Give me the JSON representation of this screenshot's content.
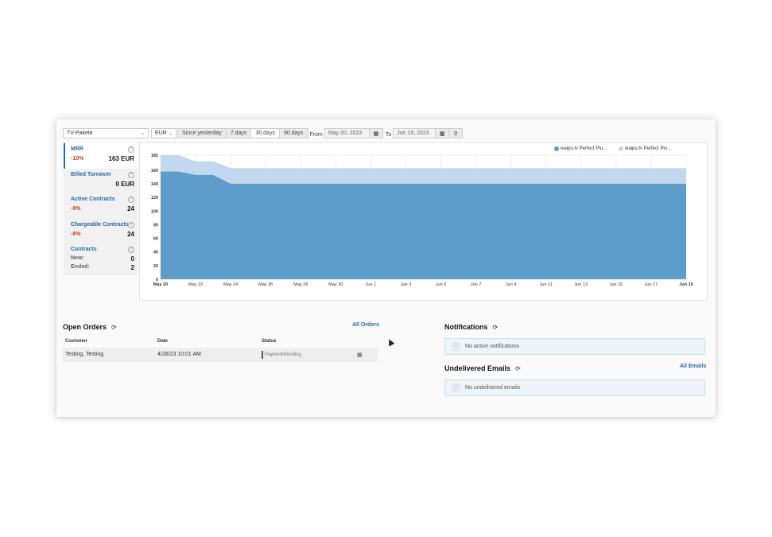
{
  "toolbar": {
    "product": "TV-Pakete",
    "currency": "EUR",
    "range_buttons": [
      "Since yesterday",
      "7 days",
      "30 days",
      "90 days"
    ],
    "active_range": "30 days",
    "from_label": "From",
    "from_date": "May 20, 2023",
    "to_label": "To",
    "to_date": "Jun 19, 2023"
  },
  "kpis": [
    {
      "title": "MRR",
      "pct": "-10%",
      "value": "163 EUR",
      "selected": true
    },
    {
      "title": "Billed Turnover",
      "pct": "",
      "value": "0 EUR"
    },
    {
      "title": "Active Contracts",
      "pct": "-8%",
      "value": "24"
    },
    {
      "title": "Chargeable Contracts",
      "pct": "-8%",
      "value": "24"
    }
  ],
  "contracts_kpi": {
    "title": "Contracts",
    "new_label": "New:",
    "new_value": "0",
    "ended_label": "Ended:",
    "ended_value": "2"
  },
  "colors": {
    "accent": "#2a66a8",
    "series1": "#5e9dca",
    "series2": "#c3d8ee",
    "negative": "#d0442b"
  },
  "chart_data": {
    "type": "area",
    "stacked": true,
    "x": [
      "May 20",
      "May 21",
      "May 22",
      "May 23",
      "May 24",
      "May 25",
      "May 26",
      "May 27",
      "May 28",
      "May 29",
      "May 30",
      "May 31",
      "Jun 1",
      "Jun 2",
      "Jun 3",
      "Jun 4",
      "Jun 5",
      "Jun 6",
      "Jun 7",
      "Jun 8",
      "Jun 9",
      "Jun 10",
      "Jun 11",
      "Jun 12",
      "Jun 13",
      "Jun 14",
      "Jun 15",
      "Jun 16",
      "Jun 17",
      "Jun 18",
      "Jun 19"
    ],
    "x_ticks": [
      "May 20",
      "May 22",
      "May 24",
      "May 26",
      "May 28",
      "May 30",
      "Jun 1",
      "Jun 3",
      "Jun 5",
      "Jun 7",
      "Jun 9",
      "Jun 11",
      "Jun 13",
      "Jun 15",
      "Jun 17",
      "Jun 19"
    ],
    "series": [
      {
        "name": "waipu.tv Perfect Plu...",
        "values": [
          158,
          158,
          153,
          153,
          140,
          140,
          140,
          140,
          140,
          140,
          140,
          140,
          140,
          140,
          140,
          140,
          140,
          140,
          140,
          140,
          140,
          140,
          140,
          140,
          140,
          140,
          140,
          140,
          140,
          140,
          140
        ]
      },
      {
        "name": "waipu.tv Perfect Plu...",
        "values": [
          24,
          24,
          20,
          20,
          23,
          23,
          23,
          23,
          23,
          23,
          23,
          23,
          23,
          23,
          23,
          23,
          23,
          23,
          23,
          23,
          23,
          23,
          23,
          23,
          23,
          23,
          23,
          23,
          23,
          23,
          23
        ]
      }
    ],
    "y_ticks": [
      0,
      20,
      40,
      60,
      80,
      100,
      120,
      140,
      160,
      182
    ],
    "ylim": [
      0,
      182
    ],
    "grid": true,
    "legend_position": "top-right"
  },
  "open_orders": {
    "title": "Open Orders",
    "all_link": "All Orders",
    "headers": [
      "Customer",
      "Date",
      "Status"
    ],
    "rows": [
      {
        "customer": "Testing, Testing",
        "date": "4/28/23 10:01 AM",
        "status": "PaymentPending"
      }
    ]
  },
  "notifications": {
    "title": "Notifications",
    "empty": "No active notifications"
  },
  "emails": {
    "title": "Undelivered Emails",
    "all_link": "All Emails",
    "empty": "No undelivered emails"
  }
}
